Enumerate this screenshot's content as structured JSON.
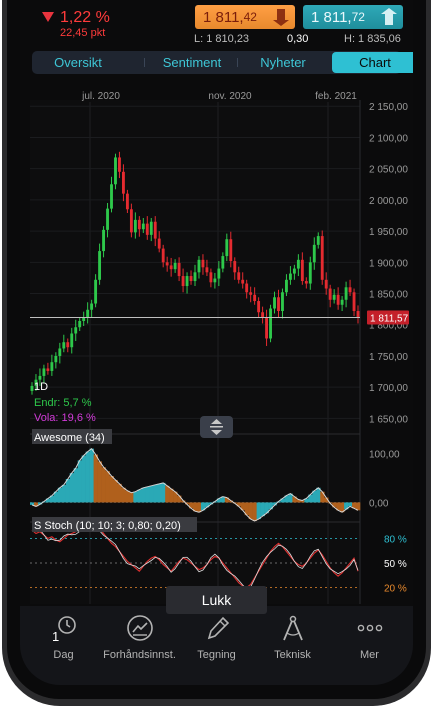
{
  "quote": {
    "change_percent": "1,22 %",
    "change_points": "22,45 pkt",
    "bid_int": "1 811,",
    "bid_dec": "42",
    "ask_int": "1 811,",
    "ask_dec": "72",
    "low": "L: 1 810,23",
    "spread": "0,30",
    "high": "H: 1 835,06",
    "colors": {
      "negative": "#ff3b3b",
      "bid": "#ff9f45",
      "ask": "#1f8e9c"
    }
  },
  "tabs": [
    {
      "label": "Oversikt",
      "active": false
    },
    {
      "label": "Sentiment",
      "active": false
    },
    {
      "label": "Nyheter",
      "active": false
    },
    {
      "label": "Chart",
      "active": true
    }
  ],
  "chart_data": [
    {
      "type": "candlestick",
      "x_labels": [
        "jul. 2020",
        "nov. 2020",
        "feb. 2021"
      ],
      "y_ticks": [
        "2 150,00",
        "2 100,00",
        "2 050,00",
        "2 000,00",
        "1 950,00",
        "1 900,00",
        "1 850,00",
        "1 800,00",
        "1 750,00",
        "1 700,00",
        "1 650,00"
      ],
      "ylim": [
        1625,
        2160
      ],
      "current_price": 1811.57,
      "current_price_label": "1 811,57",
      "interval": "1D",
      "change_label": "Endr: 5,7 %",
      "vola_label": "Vola: 19,6 %",
      "colors": {
        "up": "#2ec84b",
        "down": "#e52b30"
      },
      "close": [
        1702,
        1712,
        1718,
        1730,
        1726,
        1740,
        1750,
        1762,
        1772,
        1764,
        1786,
        1796,
        1806,
        1812,
        1824,
        1834,
        1872,
        1918,
        1952,
        1986,
        2025,
        2068,
        2045,
        2010,
        1985,
        1948,
        1968,
        1953,
        1962,
        1944,
        1965,
        1938,
        1922,
        1900,
        1895,
        1889,
        1899,
        1878,
        1862,
        1878,
        1870,
        1884,
        1904,
        1892,
        1884,
        1868,
        1874,
        1890,
        1910,
        1937,
        1902,
        1884,
        1872,
        1866,
        1852,
        1848,
        1838,
        1820,
        1812,
        1778,
        1826,
        1844,
        1822,
        1852,
        1872,
        1882,
        1890,
        1904,
        1870,
        1866,
        1900,
        1928,
        1942,
        1872,
        1858,
        1840,
        1848,
        1832,
        1840,
        1860,
        1852,
        1822,
        1812
      ],
      "panels": [
        {
          "label": "Awesome (34)",
          "y_ticks": [
            "100,00",
            "0,00"
          ],
          "ylim": [
            -40,
            140
          ],
          "values": [
            -5,
            -8,
            -4,
            2,
            8,
            14,
            22,
            30,
            36,
            48,
            60,
            70,
            86,
            96,
            104,
            110,
            98,
            84,
            72,
            64,
            54,
            46,
            38,
            30,
            24,
            20,
            22,
            26,
            30,
            32,
            34,
            36,
            38,
            40,
            34,
            28,
            22,
            14,
            4,
            -4,
            -12,
            -18,
            -20,
            -16,
            -10,
            -4,
            2,
            8,
            12,
            10,
            4,
            -2,
            -8,
            -16,
            -26,
            -34,
            -38,
            -34,
            -28,
            -22,
            -14,
            -6,
            2,
            8,
            14,
            18,
            12,
            6,
            4,
            8,
            16,
            24,
            30,
            22,
            10,
            -2,
            -10,
            -16,
            -20,
            -14,
            -8,
            -12,
            -16
          ]
        },
        {
          "label": "S Stoch (10; 10; 3; 0,80; 0,20)",
          "y_ticks": [
            "80 %",
            "50 %",
            "20 %"
          ],
          "ylim": [
            0,
            100
          ],
          "values": [
            90,
            86,
            88,
            84,
            80,
            82,
            78,
            76,
            80,
            84,
            86,
            88,
            90,
            92,
            94,
            96,
            95,
            92,
            86,
            80,
            74,
            70,
            64,
            58,
            52,
            48,
            44,
            40,
            46,
            52,
            56,
            58,
            54,
            48,
            44,
            40,
            46,
            52,
            56,
            54,
            50,
            46,
            42,
            44,
            48,
            54,
            58,
            56,
            50,
            44,
            38,
            32,
            26,
            22,
            20,
            24,
            32,
            40,
            48,
            56,
            64,
            70,
            74,
            70,
            64,
            58,
            52,
            48,
            46,
            50,
            56,
            62,
            66,
            60,
            52,
            44,
            38,
            34,
            38,
            44,
            50,
            56,
            40
          ]
        }
      ]
    }
  ],
  "panel_control": "Lukk",
  "nav": [
    {
      "label": "Dag",
      "badge": "1",
      "icon": "clock-icon"
    },
    {
      "label": "Forhåndsinnst.",
      "icon": "chart-preset-icon"
    },
    {
      "label": "Tegning",
      "icon": "pencil-icon"
    },
    {
      "label": "Teknisk",
      "icon": "compass-icon"
    },
    {
      "label": "Mer",
      "icon": "more-dots-icon"
    }
  ]
}
